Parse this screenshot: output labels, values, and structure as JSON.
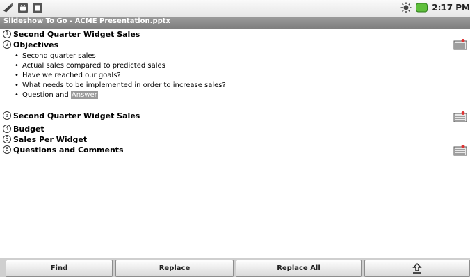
{
  "status_bar": {
    "left_icons": [
      "usb-debug-icon",
      "android-icon",
      "download-icon"
    ],
    "time": "2:17 PM",
    "right_icons": [
      "brightness-icon",
      "battery-icon"
    ]
  },
  "window": {
    "title": "Slideshow To Go - ACME Presentation.pptx"
  },
  "outline": {
    "slides": [
      {
        "number": "1",
        "title": "Second Quarter Widget Sales",
        "has_notes": false
      },
      {
        "number": "2",
        "title": "Objectives",
        "has_notes": true,
        "bullets": [
          "Second quarter sales",
          "Actual sales compared to predicted sales",
          "Have we reached our goals?",
          "What needs to be implemented in order to increase sales?",
          "Question and "
        ],
        "highlighted_word": "Answer"
      },
      {
        "number": "3",
        "title": "Second Quarter Widget Sales",
        "has_notes": true
      },
      {
        "number": "4",
        "title": "Budget",
        "has_notes": false
      },
      {
        "number": "5",
        "title": "Sales Per Widget",
        "has_notes": false
      },
      {
        "number": "6",
        "title": "Questions and Comments",
        "has_notes": true
      }
    ]
  },
  "toolbar": {
    "find_label": "Find",
    "replace_label": "Replace",
    "replace_all_label": "Replace All",
    "share_icon": "upload-icon"
  },
  "colors": {
    "title_bar": "#8c8c8c",
    "highlight": "#9a9a9a"
  }
}
